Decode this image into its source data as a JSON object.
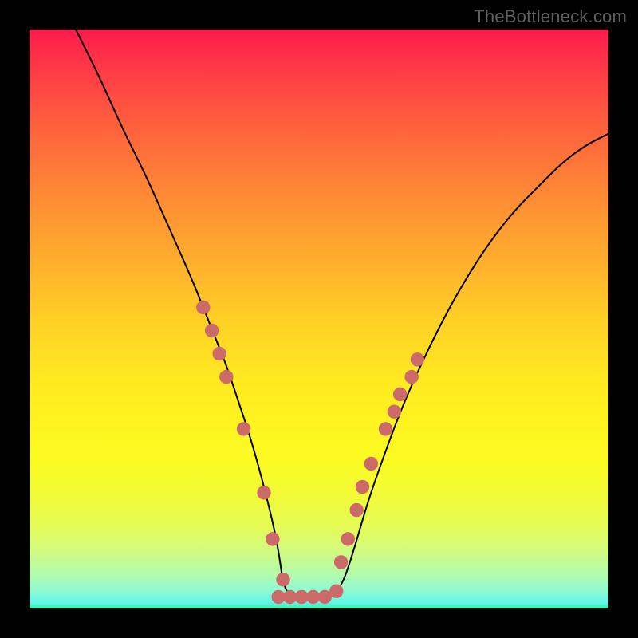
{
  "watermark": "TheBottleneck.com",
  "chart_data": {
    "type": "line",
    "title": "",
    "xlabel": "",
    "ylabel": "",
    "xlim": [
      0,
      100
    ],
    "ylim": [
      0,
      100
    ],
    "grid": false,
    "legend": false,
    "series": [
      {
        "name": "curve",
        "color": "#000000",
        "x": [
          8,
          12,
          16,
          20,
          24,
          28,
          30,
          32,
          34,
          36,
          38,
          40,
          42,
          43,
          44,
          46,
          48,
          50,
          52,
          54,
          56,
          58,
          60,
          64,
          68,
          72,
          76,
          80,
          84,
          88,
          92,
          96,
          100
        ],
        "y": [
          100,
          92,
          83,
          75,
          66,
          57,
          52,
          47,
          42,
          36,
          30,
          23,
          15,
          10,
          3,
          2,
          2,
          2,
          2,
          4,
          10,
          17,
          23,
          34,
          43,
          51,
          58,
          64,
          69,
          73,
          77,
          80,
          82
        ]
      }
    ],
    "markers": [
      {
        "name": "dots",
        "color": "#cc6a6a",
        "radius_pct": 1.2,
        "points": [
          {
            "x": 30.0,
            "y": 52
          },
          {
            "x": 31.5,
            "y": 48
          },
          {
            "x": 32.8,
            "y": 44
          },
          {
            "x": 34.0,
            "y": 40
          },
          {
            "x": 37.0,
            "y": 31
          },
          {
            "x": 40.5,
            "y": 20
          },
          {
            "x": 42.0,
            "y": 12
          },
          {
            "x": 43.8,
            "y": 5
          },
          {
            "x": 43.0,
            "y": 2
          },
          {
            "x": 45.0,
            "y": 2
          },
          {
            "x": 47.0,
            "y": 2
          },
          {
            "x": 49.0,
            "y": 2
          },
          {
            "x": 51.0,
            "y": 2
          },
          {
            "x": 53.0,
            "y": 3
          },
          {
            "x": 53.8,
            "y": 8
          },
          {
            "x": 55.0,
            "y": 12
          },
          {
            "x": 56.5,
            "y": 17
          },
          {
            "x": 57.5,
            "y": 21
          },
          {
            "x": 59.0,
            "y": 25
          },
          {
            "x": 61.5,
            "y": 31
          },
          {
            "x": 63.0,
            "y": 34
          },
          {
            "x": 64.0,
            "y": 37
          },
          {
            "x": 66.0,
            "y": 40
          },
          {
            "x": 67.0,
            "y": 43
          }
        ]
      }
    ]
  }
}
